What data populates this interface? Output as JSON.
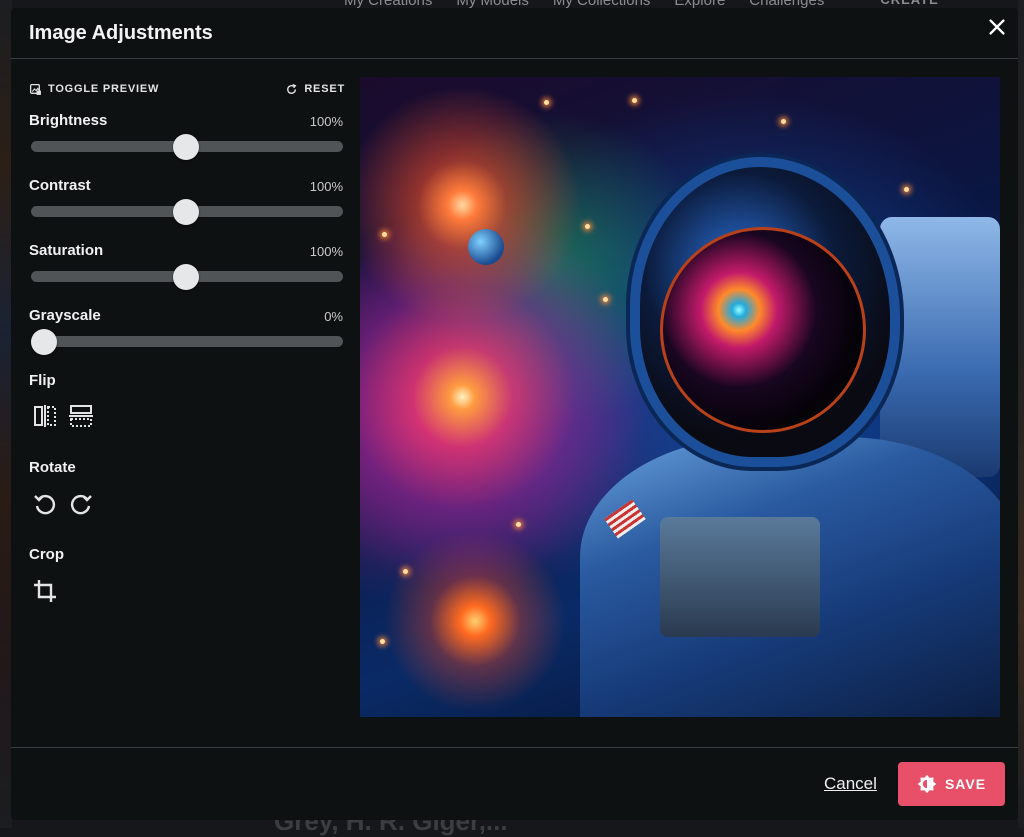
{
  "background_nav": [
    "My Creations",
    "My Models",
    "My Collections",
    "Explore",
    "Challenges",
    "CREATE"
  ],
  "background_text": "Grey, H. R. Giger,...",
  "modal": {
    "title": "Image Adjustments",
    "toggle_preview_label": "TOGGLE PREVIEW",
    "reset_label": "RESET",
    "sliders": [
      {
        "label": "Brightness",
        "value": "100%",
        "level": 0.5
      },
      {
        "label": "Contrast",
        "value": "100%",
        "level": 0.5
      },
      {
        "label": "Saturation",
        "value": "100%",
        "level": 0.5
      },
      {
        "label": "Grayscale",
        "value": "0%",
        "level": 0.0
      }
    ],
    "flip_label": "Flip",
    "rotate_label": "Rotate",
    "crop_label": "Crop",
    "cancel_label": "Cancel",
    "save_label": "SAVE",
    "icons": {
      "close": "close-icon",
      "toggle_preview": "image-edit-icon",
      "reset": "refresh-icon",
      "flip_horizontal": "flip-horizontal-icon",
      "flip_vertical": "flip-vertical-icon",
      "rotate_left": "rotate-left-icon",
      "rotate_right": "rotate-right-icon",
      "crop": "crop-icon",
      "save": "sun-contrast-icon"
    },
    "colors": {
      "save_button": "#e8506a",
      "modal_bg": "#0e1111",
      "slider_track": "#505457",
      "slider_thumb": "#e6e7e8"
    }
  }
}
